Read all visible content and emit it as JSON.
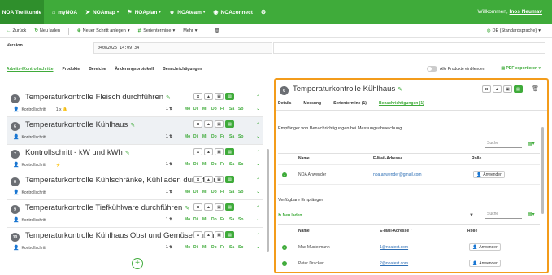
{
  "topnav": {
    "brand": "NOA Trellkunde",
    "items": [
      {
        "icon": "home-icon",
        "glyph": "⌂",
        "label": "myNOA",
        "chevron": false
      },
      {
        "icon": "map-pointer-icon",
        "glyph": "➤",
        "label": "NOAmap",
        "chevron": true
      },
      {
        "icon": "flag-icon",
        "glyph": "⚑",
        "label": "NOAplan",
        "chevron": true
      },
      {
        "icon": "team-icon",
        "glyph": "☻",
        "label": "NOAteam",
        "chevron": true
      },
      {
        "icon": "wifi-icon",
        "glyph": "◉",
        "label": "NOAconnect",
        "chevron": false
      }
    ],
    "settings_glyph": "⚙",
    "welcome_text": "Willkommen,",
    "welcome_user": "Inos Neumav"
  },
  "toolbar": {
    "back_label": "Zurück",
    "reload_label": "Neu laden",
    "new_step_label": "Neuer Schritt anlegen",
    "series_label": "Serientermine",
    "more_label": "Mehr",
    "language_label": "DE (Standardsprache)"
  },
  "version": {
    "label": "Version",
    "value": "04082025_14:09:34"
  },
  "section_tabs": {
    "items": [
      "Arbeits-/Kontrollschritte",
      "Produkte",
      "Bereiche",
      "Änderungsprotokoll",
      "Benachrichtigungen"
    ],
    "all_products_label": "Alle Produkte einblenden",
    "pdf_label": "PDF exportieren"
  },
  "steps": [
    {
      "num": "5",
      "title": "Temperaturkontrolle Fleisch durchführen",
      "type": "Kontrollschritt",
      "extra": "1 x 🔔",
      "count": "1 ⇅",
      "days": [
        "Mo",
        "Di",
        "Mi",
        "Do",
        "Fr",
        "Sa",
        "So"
      ],
      "active": false
    },
    {
      "num": "6",
      "title": "Temperaturkontrolle Kühlhaus",
      "type": "Kontrollschritt",
      "extra": "",
      "count": "1 ⇅",
      "days": [
        "Mo",
        "Di",
        "Mi",
        "Do",
        "Fr",
        "Sa",
        "So"
      ],
      "active": true
    },
    {
      "num": "7",
      "title": "Kontrollschritt - kW und kWh",
      "type": "Kontrollschritt",
      "extra": "⚡",
      "count": "1 ⇅",
      "days": [
        "Mo",
        "Di",
        "Mi",
        "Do",
        "Fr",
        "Sa",
        "So"
      ],
      "active": false
    },
    {
      "num": "8",
      "title": "Temperaturkontrolle Kühlschränke, Kühlladen durchführen",
      "type": "Kontrollschritt",
      "extra": "",
      "count": "1 ⇅",
      "days": [
        "Mo",
        "Di",
        "Mi",
        "Do",
        "Fr",
        "Sa",
        "So"
      ],
      "active": false
    },
    {
      "num": "9",
      "title": "Temperaturkontrolle Tiefkühlware durchführen",
      "type": "Kontrollschritt",
      "extra": "",
      "count": "1 ⇅",
      "days": [
        "Mo",
        "Di",
        "Mi",
        "Do",
        "Fr",
        "Sa",
        "So"
      ],
      "active": false
    },
    {
      "num": "10",
      "title": "Temperaturkontrolle Kühlhaus Obst und Gemüse durchfü...",
      "type": "Kontrollschritt",
      "extra": "",
      "count": "1 ⇅",
      "days": [
        "Mo",
        "Di",
        "Mi",
        "Do",
        "Fr",
        "Sa",
        "So"
      ],
      "active": false
    }
  ],
  "add_step_glyph": "+",
  "detail": {
    "num": "6",
    "title": "Temperaturkontrolle Kühlhaus",
    "tabs": [
      "Details",
      "Messung",
      "Serientermine (1)",
      "Benachrichtigungen (1)"
    ],
    "section1_title": "Empfänger von Benachrichtigungen bei Messungsabweichung",
    "search_placeholder": "Suche",
    "columns": {
      "name": "Name",
      "email": "E-Mail-Adresse",
      "email_sorted": "E-Mail-Adresse ↑",
      "role": "Rolle"
    },
    "assigned": [
      {
        "name": "NOA Anwender",
        "email": "noa.anwender@gmail.com",
        "role": "Anwender"
      }
    ],
    "section2_title": "Verfügbare Empfänger",
    "reload_label": "Neu laden",
    "available": [
      {
        "name": "Max Mustermann",
        "email": "1@noatest.com",
        "role": "Anwender"
      },
      {
        "name": "Peter Drucker",
        "email": "2@noatest.com",
        "role": "Anwender"
      }
    ]
  },
  "colors": {
    "brand_green": "#3fab3a",
    "highlight_orange": "#f39c1b"
  }
}
